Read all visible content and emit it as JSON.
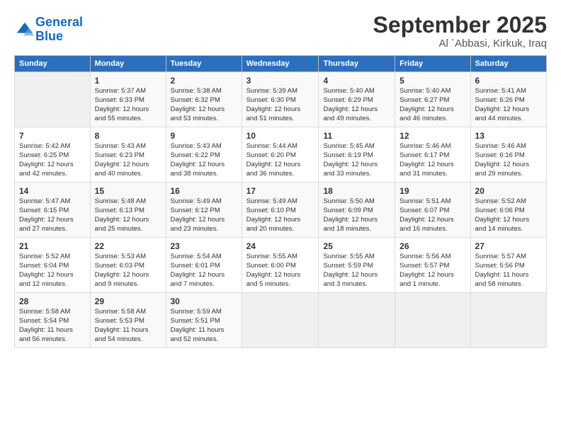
{
  "logo": {
    "line1": "General",
    "line2": "Blue"
  },
  "title": "September 2025",
  "location": "Al `Abbasi, Kirkuk, Iraq",
  "days_header": [
    "Sunday",
    "Monday",
    "Tuesday",
    "Wednesday",
    "Thursday",
    "Friday",
    "Saturday"
  ],
  "weeks": [
    [
      {
        "num": "",
        "info": ""
      },
      {
        "num": "1",
        "info": "Sunrise: 5:37 AM\nSunset: 6:33 PM\nDaylight: 12 hours\nand 55 minutes."
      },
      {
        "num": "2",
        "info": "Sunrise: 5:38 AM\nSunset: 6:32 PM\nDaylight: 12 hours\nand 53 minutes."
      },
      {
        "num": "3",
        "info": "Sunrise: 5:39 AM\nSunset: 6:30 PM\nDaylight: 12 hours\nand 51 minutes."
      },
      {
        "num": "4",
        "info": "Sunrise: 5:40 AM\nSunset: 6:29 PM\nDaylight: 12 hours\nand 49 minutes."
      },
      {
        "num": "5",
        "info": "Sunrise: 5:40 AM\nSunset: 6:27 PM\nDaylight: 12 hours\nand 46 minutes."
      },
      {
        "num": "6",
        "info": "Sunrise: 5:41 AM\nSunset: 6:26 PM\nDaylight: 12 hours\nand 44 minutes."
      }
    ],
    [
      {
        "num": "7",
        "info": "Sunrise: 5:42 AM\nSunset: 6:25 PM\nDaylight: 12 hours\nand 42 minutes."
      },
      {
        "num": "8",
        "info": "Sunrise: 5:43 AM\nSunset: 6:23 PM\nDaylight: 12 hours\nand 40 minutes."
      },
      {
        "num": "9",
        "info": "Sunrise: 5:43 AM\nSunset: 6:22 PM\nDaylight: 12 hours\nand 38 minutes."
      },
      {
        "num": "10",
        "info": "Sunrise: 5:44 AM\nSunset: 6:20 PM\nDaylight: 12 hours\nand 36 minutes."
      },
      {
        "num": "11",
        "info": "Sunrise: 5:45 AM\nSunset: 6:19 PM\nDaylight: 12 hours\nand 33 minutes."
      },
      {
        "num": "12",
        "info": "Sunrise: 5:46 AM\nSunset: 6:17 PM\nDaylight: 12 hours\nand 31 minutes."
      },
      {
        "num": "13",
        "info": "Sunrise: 5:46 AM\nSunset: 6:16 PM\nDaylight: 12 hours\nand 29 minutes."
      }
    ],
    [
      {
        "num": "14",
        "info": "Sunrise: 5:47 AM\nSunset: 6:15 PM\nDaylight: 12 hours\nand 27 minutes."
      },
      {
        "num": "15",
        "info": "Sunrise: 5:48 AM\nSunset: 6:13 PM\nDaylight: 12 hours\nand 25 minutes."
      },
      {
        "num": "16",
        "info": "Sunrise: 5:49 AM\nSunset: 6:12 PM\nDaylight: 12 hours\nand 23 minutes."
      },
      {
        "num": "17",
        "info": "Sunrise: 5:49 AM\nSunset: 6:10 PM\nDaylight: 12 hours\nand 20 minutes."
      },
      {
        "num": "18",
        "info": "Sunrise: 5:50 AM\nSunset: 6:09 PM\nDaylight: 12 hours\nand 18 minutes."
      },
      {
        "num": "19",
        "info": "Sunrise: 5:51 AM\nSunset: 6:07 PM\nDaylight: 12 hours\nand 16 minutes."
      },
      {
        "num": "20",
        "info": "Sunrise: 5:52 AM\nSunset: 6:06 PM\nDaylight: 12 hours\nand 14 minutes."
      }
    ],
    [
      {
        "num": "21",
        "info": "Sunrise: 5:52 AM\nSunset: 6:04 PM\nDaylight: 12 hours\nand 12 minutes."
      },
      {
        "num": "22",
        "info": "Sunrise: 5:53 AM\nSunset: 6:03 PM\nDaylight: 12 hours\nand 9 minutes."
      },
      {
        "num": "23",
        "info": "Sunrise: 5:54 AM\nSunset: 6:01 PM\nDaylight: 12 hours\nand 7 minutes."
      },
      {
        "num": "24",
        "info": "Sunrise: 5:55 AM\nSunset: 6:00 PM\nDaylight: 12 hours\nand 5 minutes."
      },
      {
        "num": "25",
        "info": "Sunrise: 5:55 AM\nSunset: 5:59 PM\nDaylight: 12 hours\nand 3 minutes."
      },
      {
        "num": "26",
        "info": "Sunrise: 5:56 AM\nSunset: 5:57 PM\nDaylight: 12 hours\nand 1 minute."
      },
      {
        "num": "27",
        "info": "Sunrise: 5:57 AM\nSunset: 5:56 PM\nDaylight: 11 hours\nand 58 minutes."
      }
    ],
    [
      {
        "num": "28",
        "info": "Sunrise: 5:58 AM\nSunset: 5:54 PM\nDaylight: 11 hours\nand 56 minutes."
      },
      {
        "num": "29",
        "info": "Sunrise: 5:58 AM\nSunset: 5:53 PM\nDaylight: 11 hours\nand 54 minutes."
      },
      {
        "num": "30",
        "info": "Sunrise: 5:59 AM\nSunset: 5:51 PM\nDaylight: 11 hours\nand 52 minutes."
      },
      {
        "num": "",
        "info": ""
      },
      {
        "num": "",
        "info": ""
      },
      {
        "num": "",
        "info": ""
      },
      {
        "num": "",
        "info": ""
      }
    ]
  ]
}
